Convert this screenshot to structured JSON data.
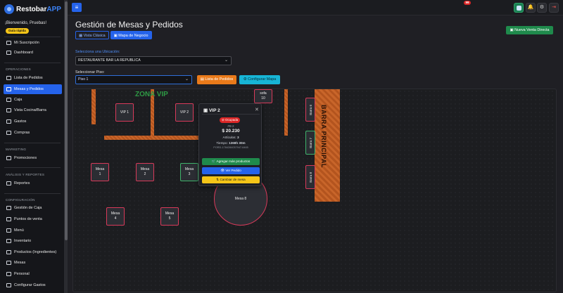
{
  "app": {
    "brand_main": "Restobar",
    "brand_accent": "APP"
  },
  "sidebar": {
    "welcome": "¡Bienvenido, Pruebas!",
    "guide_badge": "Guía rápida",
    "top_items": [
      {
        "label": "Mi Suscripción",
        "icon": "card-icon"
      },
      {
        "label": "Dashboard",
        "icon": "dashboard-icon"
      }
    ],
    "sections": {
      "operaciones": "OPERACIONES",
      "marketing": "MARKETING",
      "analisis": "ANÁLISIS Y REPORTES",
      "configuracion": "CONFIGURACIÓN"
    },
    "operaciones_items": [
      {
        "label": "Lista de Pedidos",
        "icon": "list-icon"
      },
      {
        "label": "Mesas y Pedidos",
        "icon": "table-icon",
        "active": true
      },
      {
        "label": "Caja",
        "icon": "cash-icon"
      },
      {
        "label": "Vista Cocina/Barra",
        "icon": "kitchen-icon"
      },
      {
        "label": "Gastos",
        "icon": "expense-icon"
      },
      {
        "label": "Compras",
        "icon": "cart-icon"
      }
    ],
    "marketing_items": [
      {
        "label": "Promociones",
        "icon": "promo-icon"
      }
    ],
    "analisis_items": [
      {
        "label": "Reportes",
        "icon": "chart-icon"
      }
    ],
    "configuracion_items": [
      {
        "label": "Gestión de Caja",
        "icon": "register-icon"
      },
      {
        "label": "Puntos de venta",
        "icon": "location-icon"
      },
      {
        "label": "Menú",
        "icon": "menu-book-icon"
      },
      {
        "label": "Inventario",
        "icon": "inventory-icon"
      },
      {
        "label": "Productos (Ingredientes)",
        "icon": "product-icon"
      },
      {
        "label": "Mesas",
        "icon": "tables-icon"
      },
      {
        "label": "Personal",
        "icon": "people-icon"
      },
      {
        "label": "Configurar Gastos",
        "icon": "settings-icon"
      }
    ]
  },
  "topbar": {
    "menu_icon": "hamburger-icon",
    "notification_count": "99",
    "icons": [
      "store-icon",
      "bell-icon",
      "gear-icon",
      "logout-icon"
    ]
  },
  "header": {
    "title": "Gestión de Mesas y Pedidos",
    "tabs": [
      "Vista Clásica",
      "Mapa de Negocio"
    ],
    "new_sale_button": "Nueva Venta Directa"
  },
  "filters": {
    "location_label": "Selecciona una Ubicación:",
    "location_value": "RESTAURANTE BAR LA REPUBLICA",
    "floor_label": "Seleccionar Piso:",
    "floor_value": "Piso 1",
    "orders_list_button": "Lista de Pedidos",
    "configure_map_button": "Configurar Mapa"
  },
  "map": {
    "zone_label": "ZONA VIP",
    "bar_label": "BARRA PRINCIPAL",
    "tables": {
      "vip1": "VIP 1",
      "vip2": "VIP 2",
      "sofa_name": "sofa",
      "sofa_num": "10",
      "mesa": "Mesa",
      "n1": "1",
      "n2": "2",
      "n3": "3",
      "n4": "4",
      "n5": "5",
      "mesa8": "Mesa 8"
    },
    "bar_seats": [
      "Barra 6",
      "Barra 7",
      "Barra 8"
    ]
  },
  "popup": {
    "title": "VIP 2",
    "status": "Ocupada",
    "order_id": "#8-2",
    "total": "$ 20.230",
    "items_label": "Artículos:",
    "items_value": "3",
    "time_label": "Tiempo:",
    "time_value": "1368h 30m",
    "order_code": "PORD-1784284037947-6465",
    "add_products": "Agregar más productos",
    "view_order": "Ver Pedido",
    "change_table": "Cambiar de mesa"
  }
}
